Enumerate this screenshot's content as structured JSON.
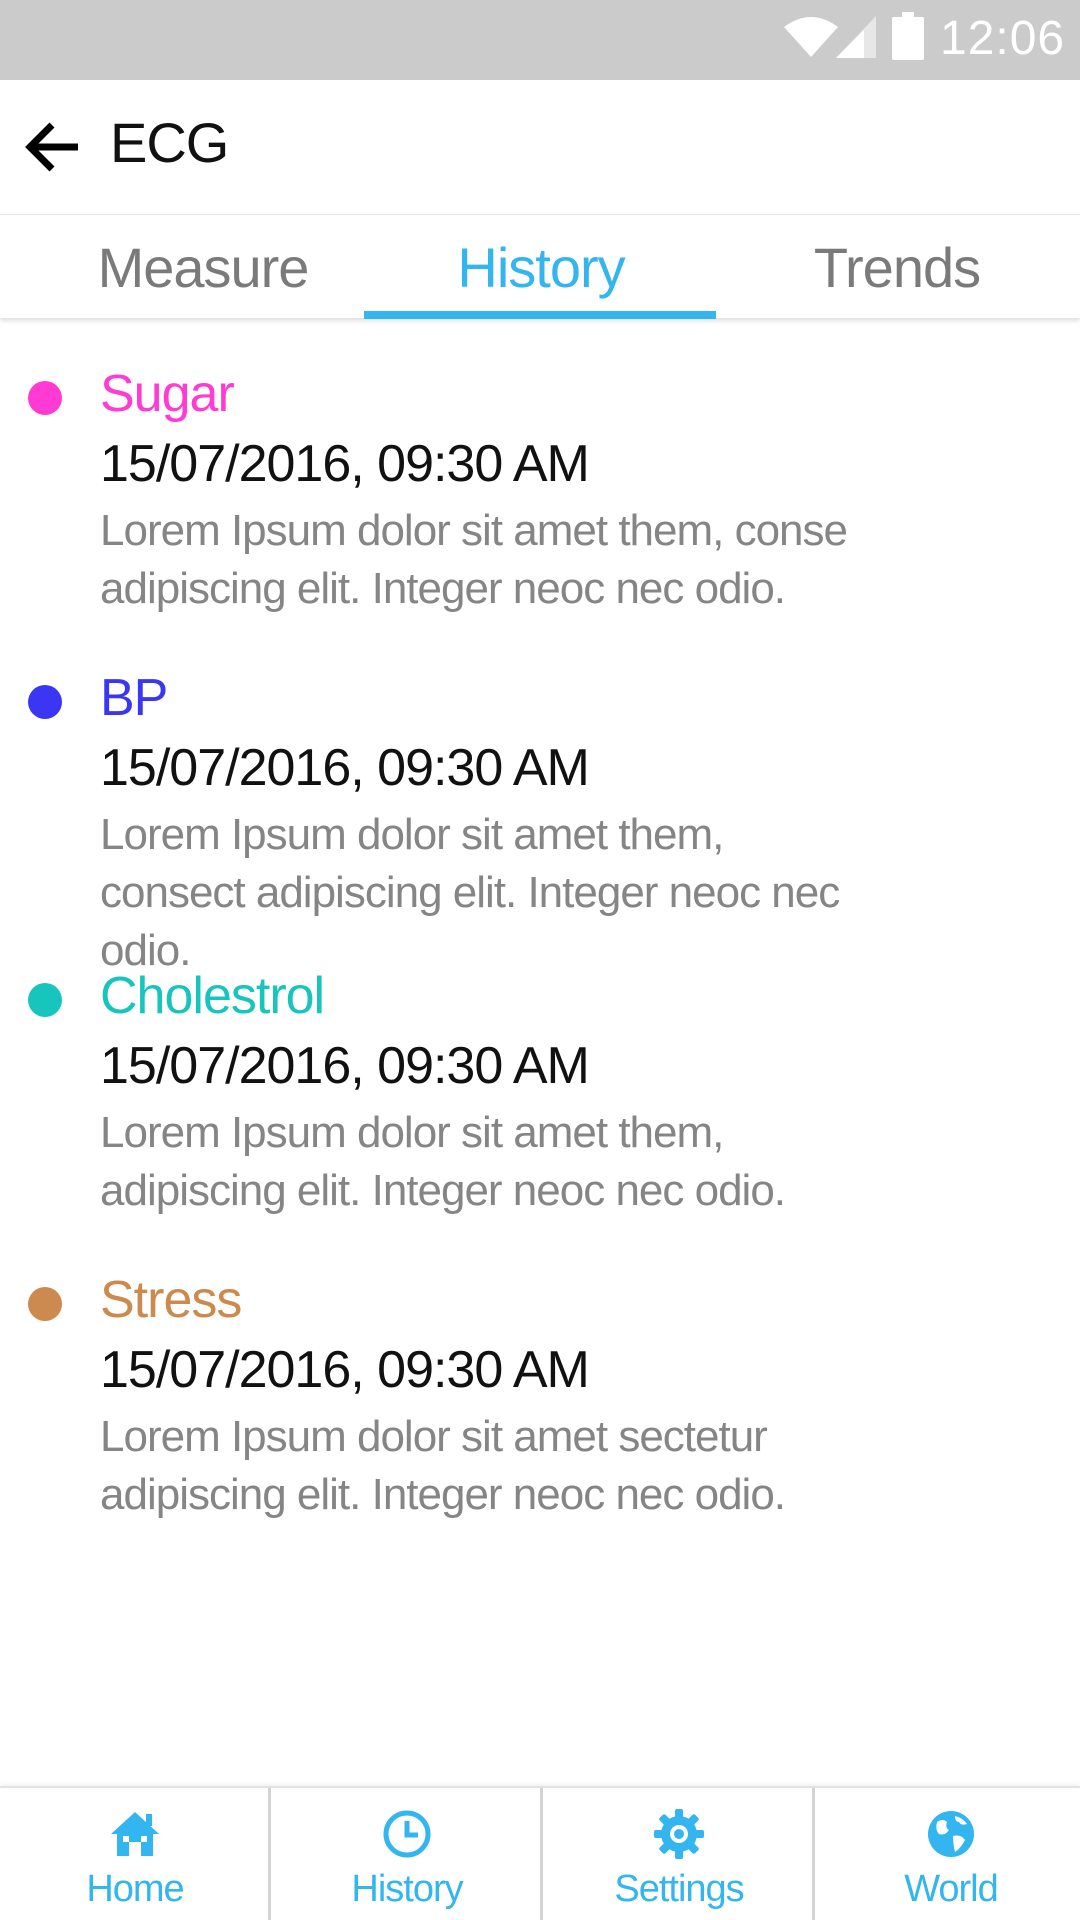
{
  "status_bar": {
    "time": "12:06",
    "icons": [
      "wifi-icon",
      "cell-signal-icon",
      "battery-icon"
    ]
  },
  "app_bar": {
    "back_icon": "arrow-back-icon",
    "title": "ECG"
  },
  "tabs": [
    {
      "label": "Measure",
      "selected": false
    },
    {
      "label": "History",
      "selected": true
    },
    {
      "label": "Trends",
      "selected": false
    }
  ],
  "history": [
    {
      "title": "Sugar",
      "color": "#ff3bd3",
      "datetime": "15/07/2016, 09:30 AM",
      "description": "Lorem Ipsum dolor sit amet them, conse adipiscing elit. Integer neoc nec odio."
    },
    {
      "title": "BP",
      "color": "#3b36f4",
      "datetime": "15/07/2016, 09:30 AM",
      "description": "Lorem Ipsum dolor sit amet them, consect adipiscing elit. Integer neoc nec odio."
    },
    {
      "title": "Cholestrol",
      "color": "#18c5bd",
      "datetime": "15/07/2016, 09:30 AM",
      "description": "Lorem Ipsum dolor sit amet them, adipiscing elit. Integer neoc nec odio."
    },
    {
      "title": "Stress",
      "color": "#cc8a4e",
      "datetime": "15/07/2016, 09:30 AM",
      "description": "Lorem Ipsum dolor sit amet sectetur adipiscing elit. Integer neoc nec odio."
    }
  ],
  "bottom_nav": [
    {
      "label": "Home",
      "icon": "home-icon"
    },
    {
      "label": "History",
      "icon": "clock-icon"
    },
    {
      "label": "Settings",
      "icon": "gear-icon"
    },
    {
      "label": "World",
      "icon": "globe-icon"
    }
  ],
  "colors": {
    "accent": "#33b5ef",
    "status_bar": "#cbcbcb"
  }
}
